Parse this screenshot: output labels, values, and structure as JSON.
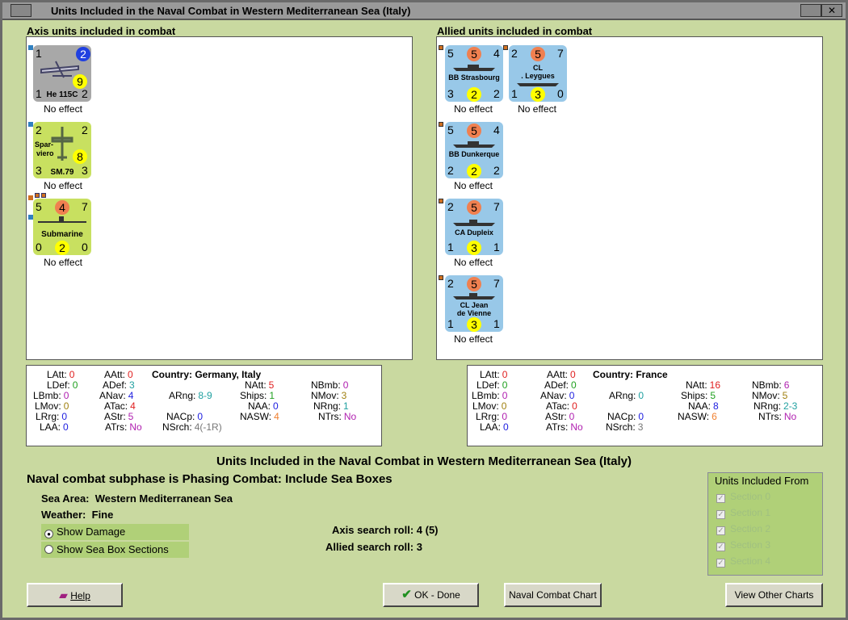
{
  "window": {
    "title": "Units Included in the Naval Combat in Western Mediterranean Sea (Italy)"
  },
  "axis": {
    "header": "Axis units included in combat",
    "units": [
      {
        "tl": "1",
        "tr": "2",
        "bl": "1",
        "br": "2",
        "mid": "9",
        "name": "He 115C",
        "effect": "No effect",
        "color": "#a8a8a8",
        "icon": "seaplane-icon"
      },
      {
        "tl": "2",
        "tr": "2",
        "bl": "3",
        "br": "3",
        "mid": "8",
        "name1": "Spar-",
        "name2": "viero",
        "name": "SM.79",
        "effect": "No effect",
        "color": "#c8e060",
        "icon": "bomber-icon"
      },
      {
        "tl": "5",
        "tr": "7",
        "top": "4",
        "bl": "0",
        "br": "0",
        "mid": "2",
        "name": "Submarine",
        "effect": "No effect",
        "color": "#c8e060",
        "icon": "submarine-icon"
      }
    ]
  },
  "allied": {
    "header": "Allied units included in combat",
    "units": [
      {
        "tl": "5",
        "top": "5",
        "tr": "4",
        "bl": "3",
        "mid": "2",
        "br": "2",
        "name": "BB Strasbourg",
        "effect": "No effect"
      },
      {
        "tl": "2",
        "top": "5",
        "tr": "7",
        "bl": "1",
        "mid": "3",
        "br": "0",
        "name": "CL",
        "name2": ". Leygues",
        "effect": "No effect"
      },
      {
        "tl": "5",
        "top": "5",
        "tr": "4",
        "bl": "2",
        "mid": "2",
        "br": "2",
        "name": "BB Dunkerque",
        "effect": "No effect"
      },
      {
        "tl": "2",
        "top": "5",
        "tr": "7",
        "bl": "1",
        "mid": "3",
        "br": "1",
        "name": "CA Dupleix",
        "effect": "No effect"
      },
      {
        "tl": "2",
        "top": "5",
        "tr": "7",
        "bl": "1",
        "mid": "3",
        "br": "1",
        "name": "CL Jean",
        "name2": "de Vienne",
        "effect": "No effect"
      }
    ]
  },
  "axis_stats": {
    "country_label": "Country:",
    "country": "Germany, Italy",
    "LAtt": "0",
    "AAtt": "0",
    "LDef": "0",
    "ADef": "3",
    "LBmb": "0",
    "ANav": "4",
    "ARng": "8-9",
    "LMov": "0",
    "ATac": "4",
    "LRrg": "0",
    "AStr": "5",
    "NACp": "0",
    "LAA": "0",
    "ATrs": "No",
    "NAtt": "5",
    "NBmb": "0",
    "Ships": "1",
    "NMov": "3",
    "NAA": "0",
    "NRng": "1",
    "NASW": "4",
    "NTrs": "No",
    "NSrch": "4(-1R)"
  },
  "allied_stats": {
    "country_label": "Country:",
    "country": "France",
    "LAtt": "0",
    "AAtt": "0",
    "LDef": "0",
    "ADef": "0",
    "LBmb": "0",
    "ANav": "0",
    "ARng": "0",
    "LMov": "0",
    "ATac": "0",
    "LRrg": "0",
    "AStr": "0",
    "NACp": "0",
    "LAA": "0",
    "ATrs": "No",
    "NAtt": "16",
    "NBmb": "6",
    "Ships": "5",
    "NMov": "5",
    "NAA": "8",
    "NRng": "2-3",
    "NASW": "6",
    "NTrs": "No",
    "NSrch": "3"
  },
  "info": {
    "heading": "Units Included in the Naval Combat in Western Mediterranean Sea (Italy)",
    "subphase": "Naval combat subphase is Phasing Combat: Include Sea Boxes",
    "sea_area_label": "Sea Area:",
    "sea_area": "Western Mediterranean Sea",
    "weather_label": "Weather:",
    "weather": "Fine",
    "show_damage": "Show Damage",
    "show_sea_box": "Show Sea Box Sections",
    "axis_roll": "Axis search roll: 4 (5)",
    "allied_roll": "Allied search roll: 3"
  },
  "sections": {
    "title": "Units Included From",
    "items": [
      "Section 0",
      "Section 1",
      "Section 2",
      "Section 3",
      "Section 4"
    ]
  },
  "buttons": {
    "help": "Help",
    "ok": "OK - Done",
    "naval_chart": "Naval Combat Chart",
    "other_charts": "View Other Charts"
  }
}
